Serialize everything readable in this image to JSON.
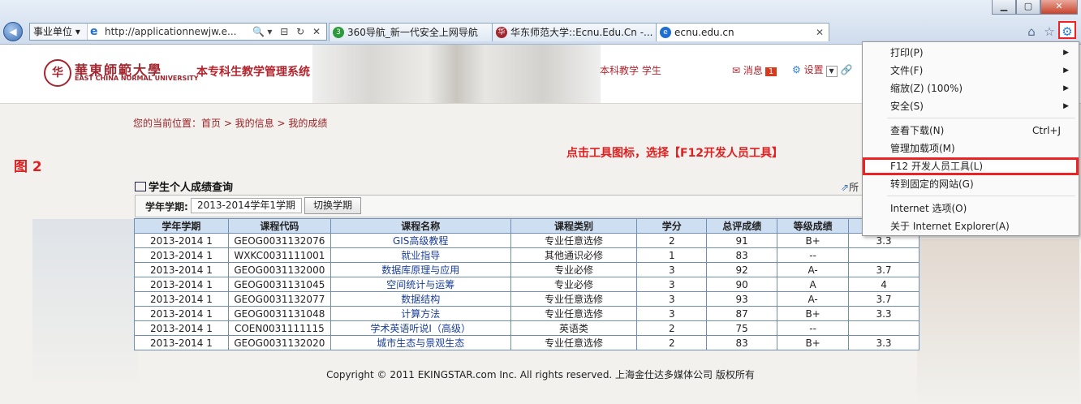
{
  "browser": {
    "zone_label": "事业单位",
    "address_url": "http://applicationnewjw.e...",
    "tabs": [
      {
        "label": "360导航_新一代安全上网导航",
        "icon": "360-icon"
      },
      {
        "label": "华东师范大学::Ecnu.Edu.Cn -...",
        "icon": "ecnu-icon"
      },
      {
        "label": "ecnu.edu.cn",
        "icon": "ie-icon",
        "active": true
      }
    ],
    "window_buttons": [
      "minimize",
      "maximize",
      "close"
    ],
    "right_icons": [
      "home-icon",
      "star-icon",
      "gear-icon"
    ]
  },
  "header": {
    "logo_cn": "華東師範大學",
    "logo_en": "EAST CHINA NORMAL UNIVERSITY",
    "system_name": "本专科生教学管理系统",
    "user_role": "本科教学 学生",
    "messages_label": "消息",
    "messages_count": "1",
    "settings_label": "设置"
  },
  "breadcrumb": "您的当前位置：首页 > 我的信息 > 我的成绩",
  "figure_label": "图 2",
  "instruction": "点击工具图标，选择【F12开发人员工具】",
  "grades": {
    "title": "学生个人成绩查询",
    "expand_label": "所",
    "term_label": "学年学期:",
    "term_value": "2013-2014学年1学期",
    "switch_button": "切换学期",
    "columns": [
      "学年学期",
      "课程代码",
      "课程名称",
      "课程类别",
      "学分",
      "总评成绩",
      "等级成绩",
      ""
    ],
    "rows": [
      [
        "2013-2014 1",
        "GEOG0031132076",
        "GIS高级教程",
        "专业任意选修",
        "2",
        "91",
        "B+",
        "3.3"
      ],
      [
        "2013-2014 1",
        "WXKC0031111001",
        "就业指导",
        "其他通识必修",
        "1",
        "83",
        "--",
        ""
      ],
      [
        "2013-2014 1",
        "GEOG0031132000",
        "数据库原理与应用",
        "专业必修",
        "3",
        "92",
        "A-",
        "3.7"
      ],
      [
        "2013-2014 1",
        "GEOG0031131045",
        "空间统计与运筹",
        "专业必修",
        "3",
        "90",
        "A",
        "4"
      ],
      [
        "2013-2014 1",
        "GEOG0031132077",
        "数据结构",
        "专业任意选修",
        "3",
        "93",
        "A-",
        "3.7"
      ],
      [
        "2013-2014 1",
        "GEOG0031131048",
        "计算方法",
        "专业任意选修",
        "3",
        "87",
        "B+",
        "3.3"
      ],
      [
        "2013-2014 1",
        "COEN0031111115",
        "学术英语听说I（高级）",
        "英语类",
        "2",
        "75",
        "--",
        ""
      ],
      [
        "2013-2014 1",
        "GEOG0031132020",
        "城市生态与景观生态",
        "专业任意选修",
        "2",
        "83",
        "B+",
        "3.3"
      ]
    ]
  },
  "footer": "Copyright © 2011 EKINGSTAR.com Inc. All rights reserved. 上海金仕达多媒体公司 版权所有",
  "tools_menu": {
    "items": [
      {
        "label": "打印(P)",
        "submenu": true
      },
      {
        "label": "文件(F)",
        "submenu": true
      },
      {
        "label": "缩放(Z) (100%)",
        "submenu": true
      },
      {
        "label": "安全(S)",
        "submenu": true
      },
      {
        "separator": true
      },
      {
        "label": "查看下载(N)",
        "shortcut": "Ctrl+J"
      },
      {
        "label": "管理加载项(M)"
      },
      {
        "label": "F12 开发人员工具(L)",
        "highlighted": true
      },
      {
        "label": "转到固定的网站(G)"
      },
      {
        "separator": true
      },
      {
        "label": "Internet 选项(O)"
      },
      {
        "label": "关于 Internet Explorer(A)"
      }
    ]
  }
}
